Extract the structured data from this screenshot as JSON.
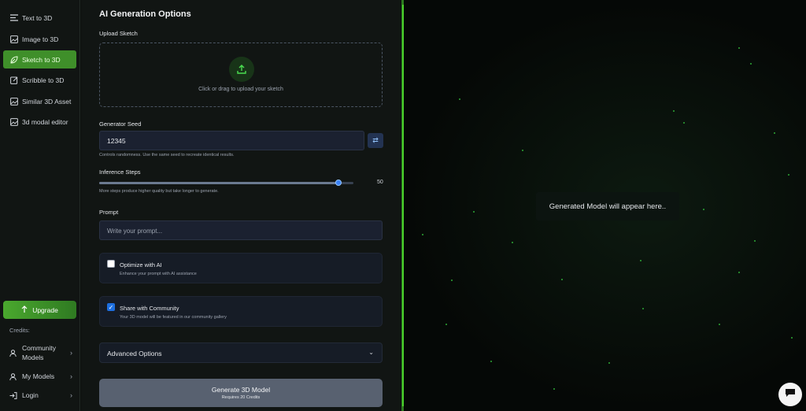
{
  "sidebar": {
    "items": [
      {
        "label": "Text to 3D",
        "icon": "text-lines-icon"
      },
      {
        "label": "Image to 3D",
        "icon": "image-icon"
      },
      {
        "label": "Sketch to 3D",
        "icon": "leaf-icon",
        "active": true
      },
      {
        "label": "Scribble to 3D",
        "icon": "edit-icon"
      },
      {
        "label": "Similar 3D Asset",
        "icon": "image-icon"
      },
      {
        "label": "3d modal editor",
        "icon": "image-icon"
      }
    ],
    "upgrade_label": "Upgrade",
    "credits_label": "Credits:",
    "bottom": [
      {
        "label": "Community Models",
        "icon": "user-icon"
      },
      {
        "label": "My Models",
        "icon": "user-icon"
      },
      {
        "label": "Login",
        "icon": "login-icon"
      }
    ]
  },
  "form": {
    "title": "AI Generation Options",
    "upload": {
      "label": "Upload Sketch",
      "hint": "Click or drag to upload your sketch"
    },
    "seed": {
      "label": "Generator Seed",
      "value": "12345",
      "help": "Controls randomness. Use the same seed to recreate identical results."
    },
    "steps": {
      "label": "Inference Steps",
      "value": "50",
      "fraction": 0.94,
      "help": "More steps produce higher quality but take longer to generate."
    },
    "prompt": {
      "label": "Prompt",
      "placeholder": "Write your prompt..."
    },
    "optimize": {
      "title": "Optimize with AI",
      "subtitle": "Enhance your prompt with AI assistance",
      "checked": false
    },
    "share": {
      "title": "Share with Community",
      "subtitle": "Your 3D model will be featured in our community gallery",
      "checked": true
    },
    "advanced_label": "Advanced Options",
    "generate": {
      "title": "Generate 3D Model",
      "subtitle": "Requires 20 Credits"
    }
  },
  "viewer": {
    "placeholder": "Generated Model will appear here.."
  },
  "colors": {
    "accent": "#3f8f2a",
    "divider": "#4ad02b",
    "checkbox": "#1d6fe0"
  }
}
